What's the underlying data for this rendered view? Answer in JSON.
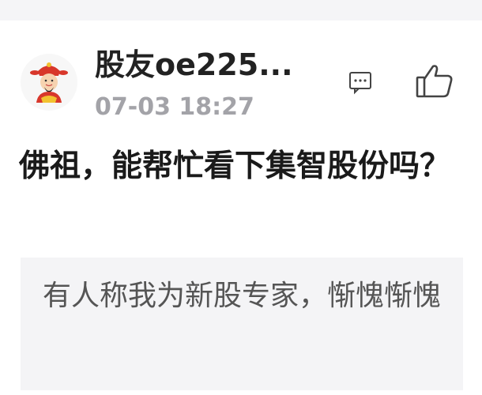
{
  "post": {
    "username": "股友oe225...",
    "timestamp": "07-03 18:27",
    "content": "佛祖，能帮忙看下集智股份吗？",
    "quote": "有人称我为新股专家，惭愧惭愧"
  },
  "icons": {
    "avatar": "caishen-avatar-icon",
    "comment": "comment-icon",
    "like": "thumbs-up-icon"
  },
  "colors": {
    "username": "#222222",
    "timestamp": "#a3a3a8",
    "content": "#1a1a1a",
    "quote_bg": "#f4f4f6",
    "quote_text": "#555555"
  }
}
